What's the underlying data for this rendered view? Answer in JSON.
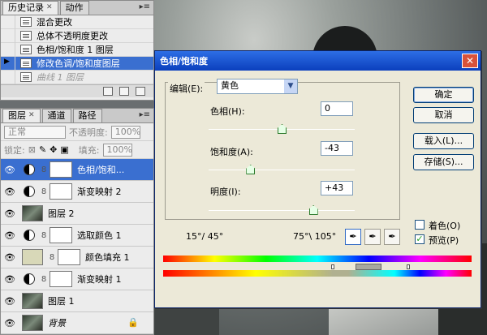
{
  "history_panel": {
    "tabs": [
      "历史记录",
      "动作"
    ],
    "items": [
      {
        "label": "混合更改",
        "state": "normal"
      },
      {
        "label": "总体不透明度更改",
        "state": "normal"
      },
      {
        "label": "色相/饱和度 1 图层",
        "state": "normal"
      },
      {
        "label": "修改色调/饱和度图层",
        "state": "selected"
      },
      {
        "label": "曲线 1 图层",
        "state": "dimmed"
      }
    ]
  },
  "layers_panel": {
    "tabs": [
      "图层",
      "通道",
      "路径"
    ],
    "blend_mode": "正常",
    "opacity_label": "不透明度:",
    "opacity_value": "100%",
    "lock_label": "锁定:",
    "fill_label": "填充:",
    "fill_value": "100%",
    "layers": [
      {
        "name": "色相/饱和...",
        "type": "adjustment",
        "selected": true
      },
      {
        "name": "渐变映射 2",
        "type": "adjustment"
      },
      {
        "name": "图层 2",
        "type": "image"
      },
      {
        "name": "选取颜色 1",
        "type": "adjustment"
      },
      {
        "name": "颜色填充 1",
        "type": "fill"
      },
      {
        "name": "渐变映射 1",
        "type": "adjustment"
      },
      {
        "name": "图层 1",
        "type": "image"
      },
      {
        "name": "背景",
        "type": "background"
      }
    ]
  },
  "dialog": {
    "title": "色相/饱和度",
    "edit_label": "编辑(E):",
    "edit_value": "黄色",
    "hue_label": "色相(H):",
    "hue_value": "0",
    "hue_level": 0,
    "saturation_label": "饱和度(A):",
    "saturation_value": "-43",
    "saturation_level": -43,
    "lightness_label": "明度(I):",
    "lightness_value": "+43",
    "lightness_level": 43,
    "range_left": "15°/ 45°",
    "range_right": "75°\\ 105°",
    "buttons": {
      "ok": "确定",
      "cancel": "取消",
      "load": "载入(L)...",
      "save": "存储(S)..."
    },
    "colorize_label": "着色(O)",
    "colorize_checked": false,
    "preview_label": "预览(P)",
    "preview_checked": true
  }
}
